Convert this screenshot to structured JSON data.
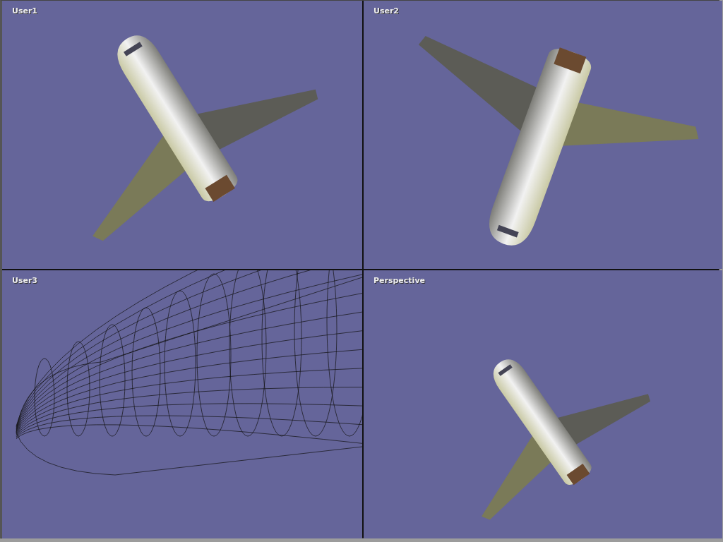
{
  "viewports": [
    {
      "label": "User1",
      "kind": "shaded"
    },
    {
      "label": "User2",
      "kind": "shaded"
    },
    {
      "label": "User3",
      "kind": "wireframe"
    },
    {
      "label": "Perspective",
      "kind": "shaded"
    }
  ]
}
